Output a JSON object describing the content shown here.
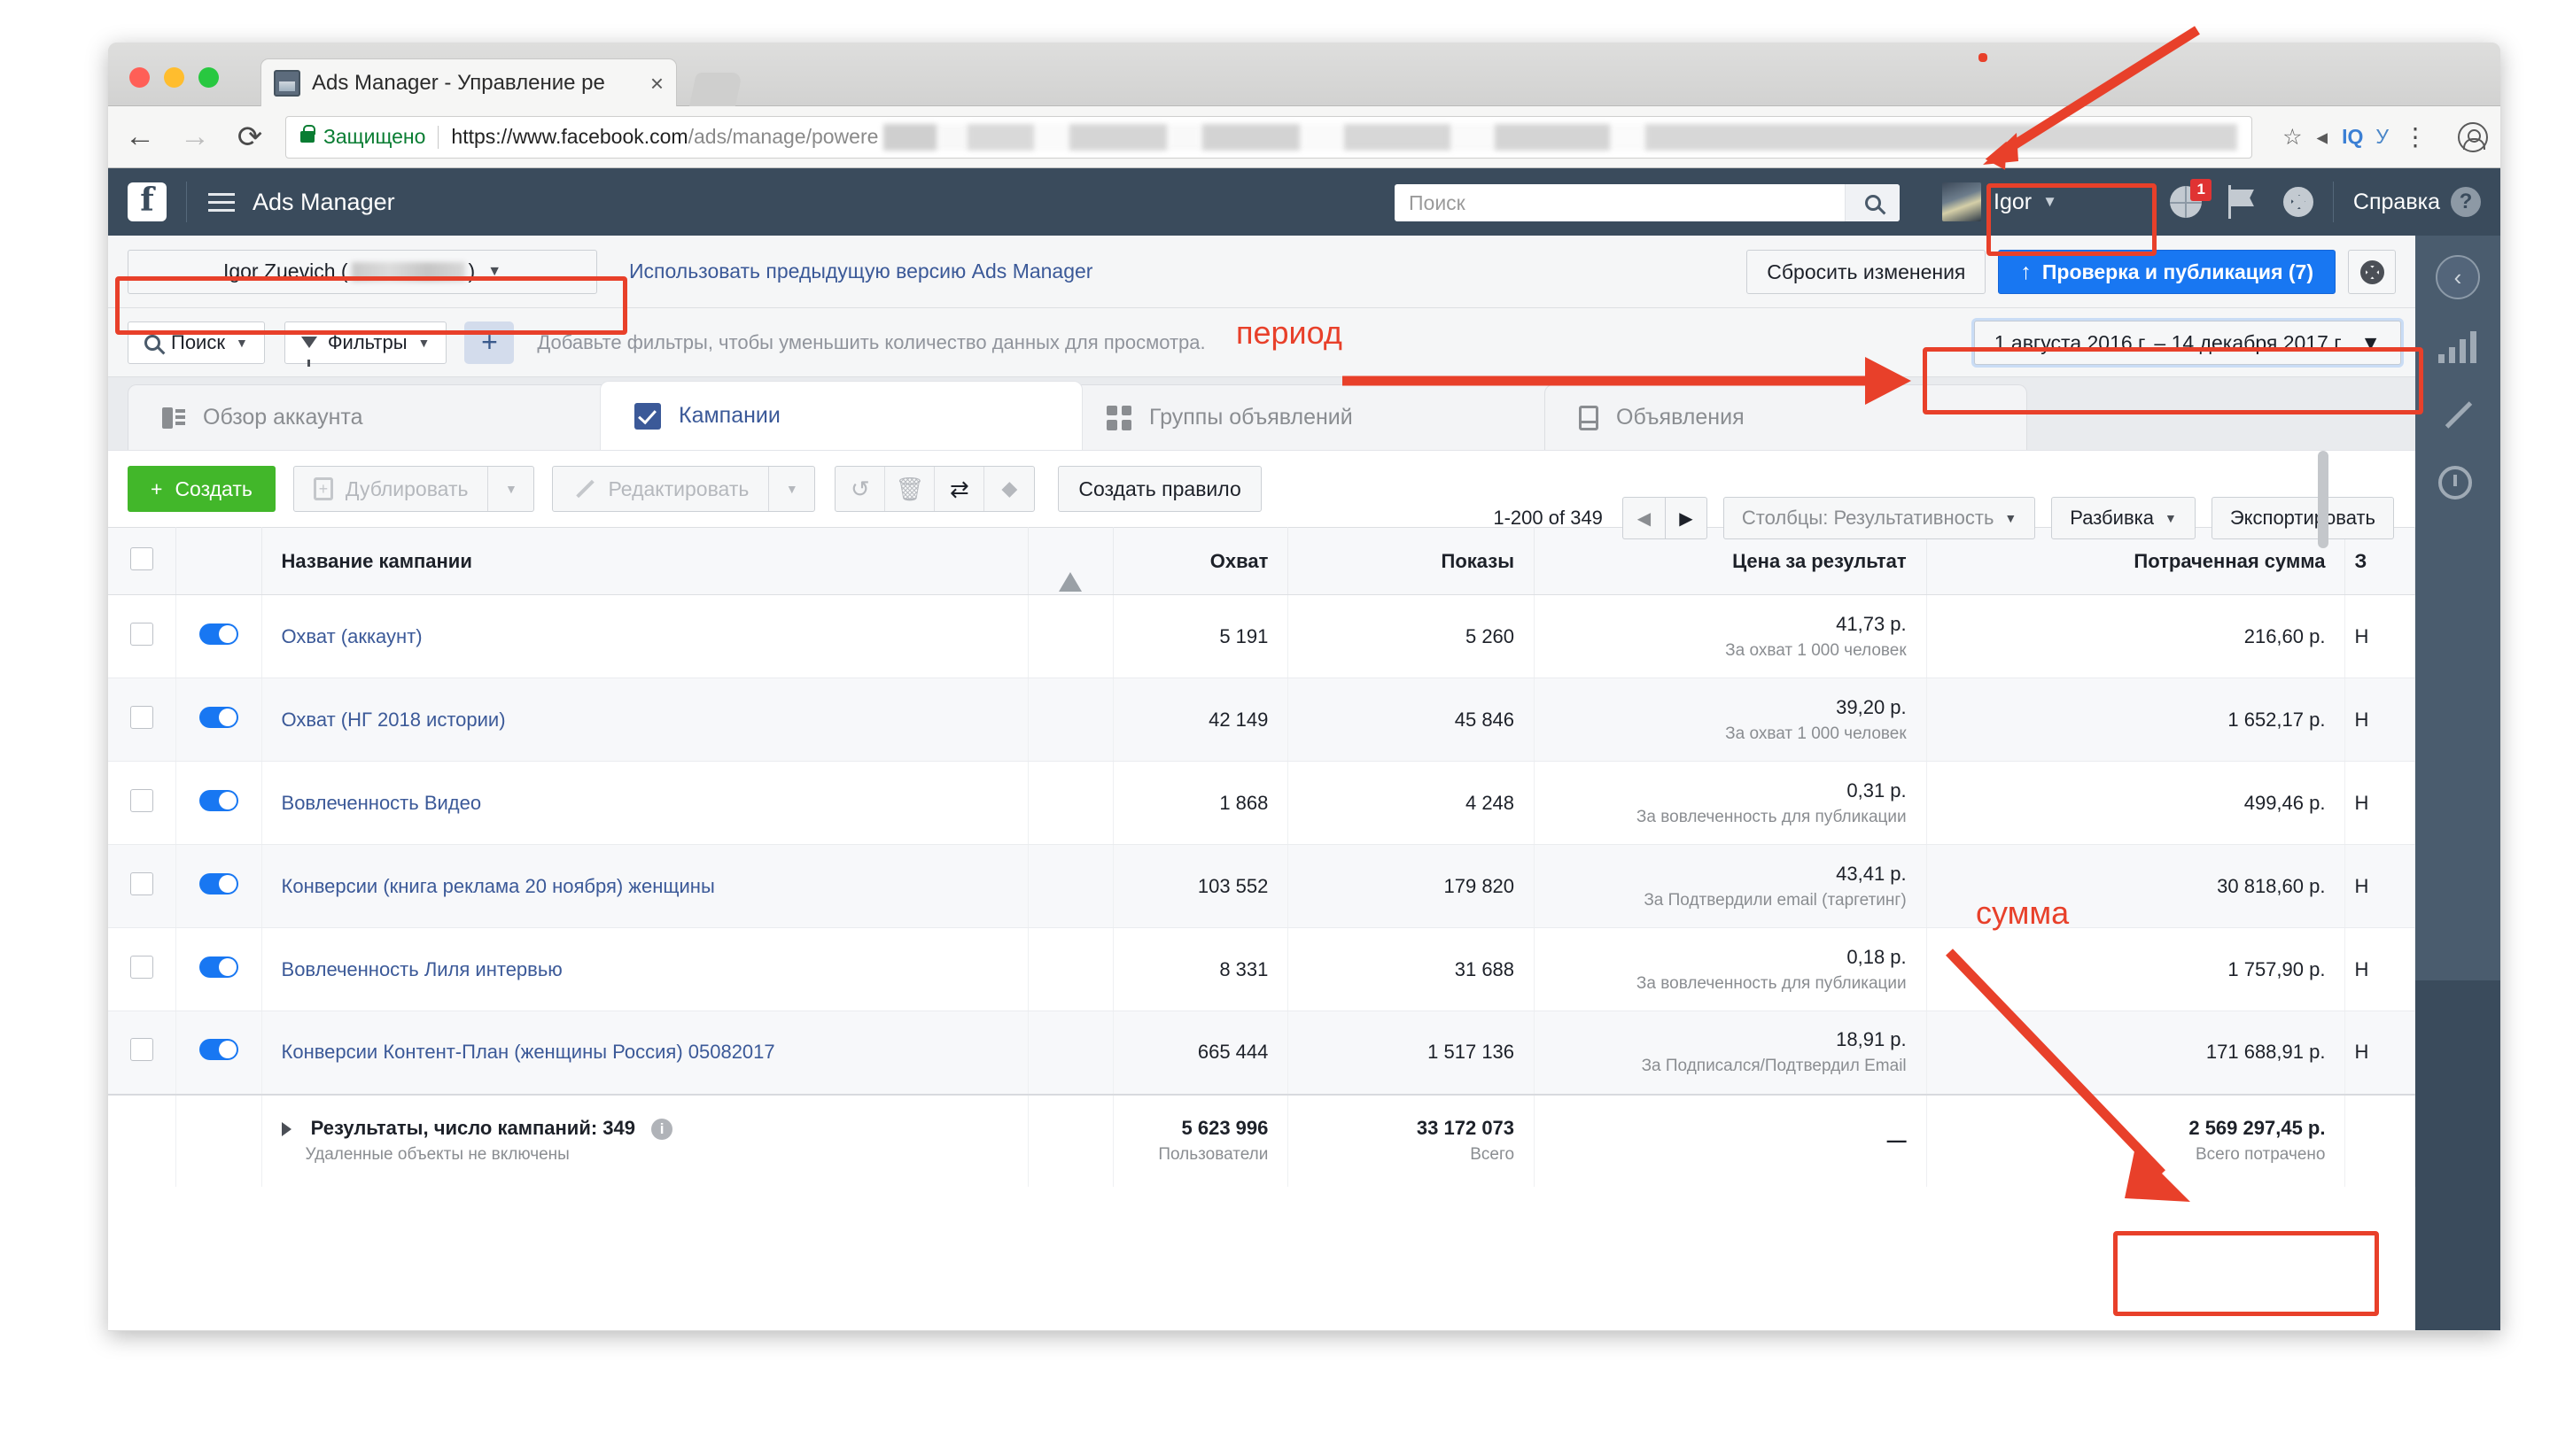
{
  "browser": {
    "tab_title": "Ads Manager - Управление ре",
    "tab_title_faded": "",
    "close_glyph": "×",
    "back_glyph": "←",
    "forward_glyph": "→",
    "reload_glyph": "⟳",
    "secure_label": "Защищено",
    "url_strong": "https://www.facebook.com",
    "url_rest": "/ads/manage/powere",
    "star_glyph": "☆",
    "iq_label": "IQ",
    "y_label": "У",
    "menu_glyph": "⋮"
  },
  "fbnav": {
    "title": "Ads Manager",
    "logo": "f",
    "search_placeholder": "Поиск",
    "search_value": "",
    "user_name": "Igor",
    "user_caret": "▼",
    "notification_badge": "1",
    "help_label": "Справка",
    "help_glyph": "?"
  },
  "toolbar": {
    "account_name": "Igor Zuevich (",
    "account_name_close": ")",
    "account_caret": "▼",
    "prev_version_link": "Использовать предыдущую версию Ads Manager",
    "reset_changes": "Сбросить изменения",
    "publish_label": "Проверка и публикация (7)",
    "publish_arrow": "↑"
  },
  "filterbar": {
    "search_label": "Поиск",
    "filters_label": "Фильтры",
    "plus_label": "+",
    "hint": "Добавьте фильтры, чтобы уменьшить количество данных для просмотра.",
    "date_range": "1 августа 2016 г. – 14 декабря 2017 г.",
    "date_caret": "▼"
  },
  "tabs": [
    {
      "label": "Обзор аккаунта",
      "icon": "overview-icon",
      "active": false
    },
    {
      "label": "Кампании",
      "icon": "campaigns-check-icon",
      "active": true
    },
    {
      "label": "Группы объявлений",
      "icon": "adsets-grid-icon",
      "active": false
    },
    {
      "label": "Объявления",
      "icon": "ads-phone-icon",
      "active": false
    }
  ],
  "actions": {
    "create": "Создать",
    "create_plus": "+",
    "duplicate": "Дублировать",
    "edit": "Редактировать",
    "caret": "▼",
    "revert_glyph": "↺",
    "trash_glyph": "🗑",
    "preview_glyph": "⇄",
    "tag_glyph": "🏷",
    "rule": "Создать правило",
    "pager_count": "1-200 of 349",
    "pager_prev": "◀",
    "pager_next": "▶",
    "columns": "Столбцы: Результативность",
    "breakdown": "Разбивка",
    "export": "Экспортировать"
  },
  "table": {
    "headers": {
      "checkbox": "",
      "toggle": "",
      "name": "Название кампании",
      "warning": "warning-icon",
      "reach": "Охват",
      "impressions": "Показы",
      "cost_per_result": "Цена за результат",
      "amount_spent": "Потраченная сумма",
      "next": "З"
    },
    "rows": [
      {
        "name": "Охват (аккаунт)",
        "reach": "5 191",
        "impressions": "5 260",
        "cost": "41,73 р.",
        "cost_sub": "За охват 1 000 человек",
        "spent": "216,60 р.",
        "next": "Н"
      },
      {
        "name": "Охват (НГ 2018 истории)",
        "reach": "42 149",
        "impressions": "45 846",
        "cost": "39,20 р.",
        "cost_sub": "За охват 1 000 человек",
        "spent": "1 652,17 р.",
        "next": "Н"
      },
      {
        "name": "Вовлеченность Видео",
        "reach": "1 868",
        "impressions": "4 248",
        "cost": "0,31 р.",
        "cost_sub": "За вовлеченность для публикации",
        "spent": "499,46 р.",
        "next": "Н"
      },
      {
        "name": "Конверсии (книга реклама 20 ноября) женщины",
        "reach": "103 552",
        "impressions": "179 820",
        "cost": "43,41 р.",
        "cost_sub": "За Подтвердили email (таргетинг)",
        "spent": "30 818,60 р.",
        "next": "Н"
      },
      {
        "name": "Вовлеченность Лиля интервью",
        "reach": "8 331",
        "impressions": "31 688",
        "cost": "0,18 р.",
        "cost_sub": "За вовлеченность для публикации",
        "spent": "1 757,90 р.",
        "next": "Н"
      },
      {
        "name": "Конверсии Контент-План (женщины Россия) 05082017",
        "reach": "665 444",
        "impressions": "1 517 136",
        "cost": "18,91 р.",
        "cost_sub": "За Подписался/Подтвердил Email",
        "spent": "171 688,91 р.",
        "next": "Н"
      }
    ],
    "footer": {
      "label": "Результаты, число кампаний: 349",
      "sub": "Удаленные объекты не включены",
      "reach": "5 623 996",
      "reach_sub": "Пользователи",
      "impressions": "33 172 073",
      "impressions_sub": "Всего",
      "cost": "—",
      "spent": "2 569 297,45 р.",
      "spent_sub": "Всего потрачено"
    }
  },
  "annotations": {
    "period_label": "период",
    "amount_label": "сумма"
  },
  "colors": {
    "fb_blue": "#1877f2",
    "fb_navy": "#3b5998",
    "nav_dark": "#3a4b5c",
    "green": "#42b72a",
    "annotation_red": "#e8402a"
  }
}
